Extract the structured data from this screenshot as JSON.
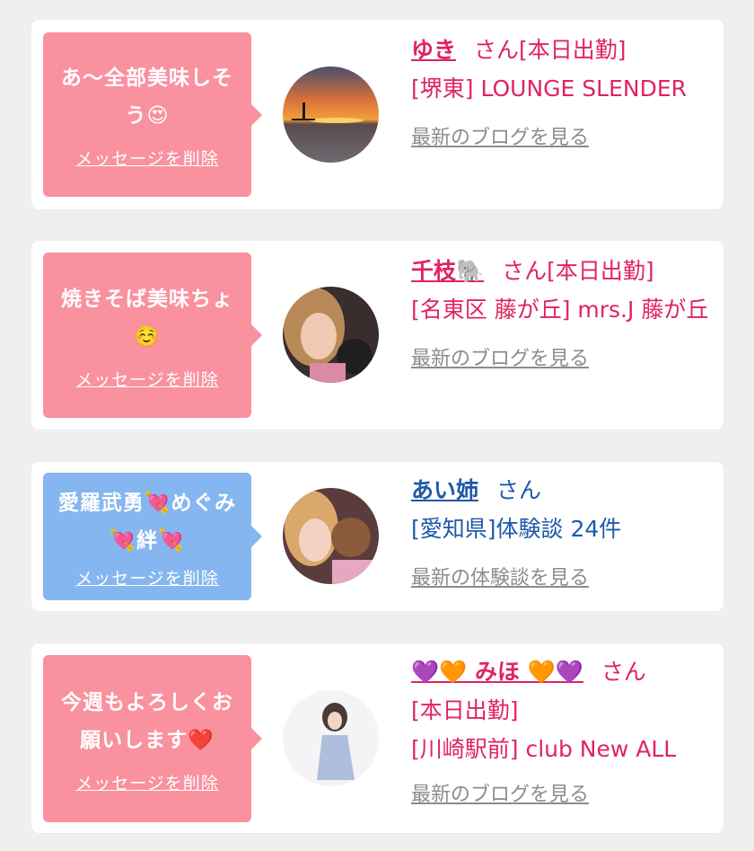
{
  "items": [
    {
      "message": "あ〜全部美味しそう😍",
      "delete_label": "メッセージを削除",
      "name": "ゆき",
      "honorific": "さん[本日出勤]",
      "detail": "[堺東] LOUNGE SLENDER",
      "more_label": "最新のブログを見る",
      "avatar": "sunset-paddleboard-photo"
    },
    {
      "message": "焼きそば美味ちょ☺️",
      "delete_label": "メッセージを削除",
      "name": "千枝🐘",
      "honorific": "さん[本日出勤]",
      "detail": "[名東区 藤が丘] mrs.J 藤が丘",
      "more_label": "最新のブログを見る",
      "avatar": "woman-selfie-photo"
    },
    {
      "message": "愛羅武勇💘めぐみ💘絆💘",
      "delete_label": "メッセージを削除",
      "name": "あい姉",
      "honorific": "さん",
      "detail": "[愛知県]体験談 24件",
      "more_label": "最新の体験談を見る",
      "avatar": "couple-selfie-photo"
    },
    {
      "message": "今週もよろしくお願いします❤️",
      "delete_label": "メッセージを削除",
      "name": "💜🧡 みほ 🧡💜",
      "honorific": "さん",
      "status": "[本日出勤]",
      "detail": "[川崎駅前] club New ALL",
      "more_label": "最新のブログを見る",
      "avatar": "woman-in-dress-photo"
    }
  ],
  "colors": {
    "bubble_pink": "#f9919f",
    "bubble_blue": "#86b6ef",
    "name_pink": "#e0245e",
    "name_blue": "#1e5aa8"
  }
}
